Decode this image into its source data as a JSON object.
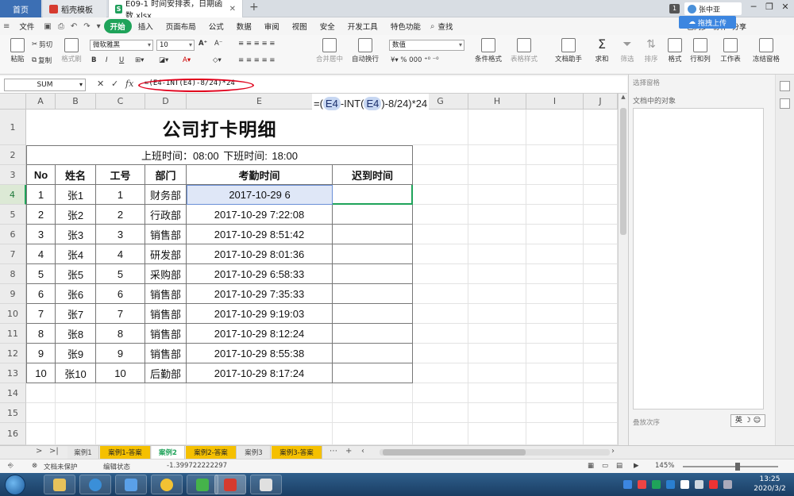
{
  "titlebar": {
    "home_tab": "首页",
    "wps_tab": "稻壳模板",
    "doc_tab": "E09-1 时间安排表，日期函数.xlsx",
    "new_tab": "+",
    "badge": "1",
    "user": "张中亚"
  },
  "menubar": {
    "file": "文件",
    "items": [
      "开始",
      "插入",
      "页面布局",
      "公式",
      "数据",
      "审阅",
      "视图",
      "安全",
      "开发工具",
      "特色功能"
    ],
    "search": "查找",
    "sync": "已同步",
    "collab": "协作",
    "share": "分享",
    "upload": "拖拽上传"
  },
  "ribbon": {
    "paste": "粘贴",
    "cut": "剪切",
    "copy": "复制",
    "format_painter": "格式刷",
    "font_name": "微软雅黑",
    "font_size": "10",
    "merge": "合并居中",
    "wrap": "自动换行",
    "number_format": "数值",
    "cond_format": "条件格式",
    "table_style": "表格样式",
    "doc_assistant": "文档助手",
    "sum": "求和",
    "filter": "筛选",
    "sort": "排序",
    "format": "格式",
    "rowcol": "行和列",
    "worksheet": "工作表",
    "freeze": "冻结窗格"
  },
  "formulabar": {
    "name_box": "SUM",
    "formula": "=(E4-INT(E4)-8/24)*24"
  },
  "columns": [
    "A",
    "B",
    "C",
    "D",
    "E",
    "F",
    "G",
    "H",
    "I",
    "J"
  ],
  "rows": [
    "1",
    "2",
    "3",
    "4",
    "5",
    "6",
    "7",
    "8",
    "9",
    "10",
    "11",
    "12",
    "13",
    "14",
    "15",
    "16"
  ],
  "sheet": {
    "title": "公司打卡明细",
    "time_line": "上班时间：08:00    下班时间: 18:00",
    "headers": [
      "No",
      "姓名",
      "工号",
      "部门",
      "考勤时间",
      "迟到时间"
    ],
    "records": [
      [
        "1",
        "张1",
        "1",
        "财务部",
        "2017-10-29 6"
      ],
      [
        "2",
        "张2",
        "2",
        "行政部",
        "2017-10-29 7:22:08"
      ],
      [
        "3",
        "张3",
        "3",
        "销售部",
        "2017-10-29 8:51:42"
      ],
      [
        "4",
        "张4",
        "4",
        "研发部",
        "2017-10-29 8:01:36"
      ],
      [
        "5",
        "张5",
        "5",
        "采购部",
        "2017-10-29 6:58:33"
      ],
      [
        "6",
        "张6",
        "6",
        "销售部",
        "2017-10-29 7:35:33"
      ],
      [
        "7",
        "张7",
        "7",
        "销售部",
        "2017-10-29 9:19:03"
      ],
      [
        "8",
        "张8",
        "8",
        "销售部",
        "2017-10-29 8:12:24"
      ],
      [
        "9",
        "张9",
        "9",
        "销售部",
        "2017-10-29 8:55:38"
      ],
      [
        "10",
        "张10",
        "10",
        "后勤部",
        "2017-10-29 8:17:24"
      ]
    ],
    "editing_formula": {
      "prefix": "=(",
      "ref1": "E4",
      "mid": "-INT(",
      "ref2": "E4",
      "suffix": ")-8/24)*24"
    }
  },
  "sidepane": {
    "title": "选择窗格",
    "label": "文档中的对象",
    "order": "叠放次序",
    "ime": "英 ☽ ☺"
  },
  "sheettabs": [
    "案例1",
    "案例1-答案",
    "案例2",
    "案例2-答案",
    "案例3",
    "案例3-答案"
  ],
  "statusbar": {
    "protect": "文档未保护",
    "edit_state": "编辑状态",
    "value": "-1.399722222297",
    "zoom": "145%"
  },
  "taskbar": {
    "time": "13:25",
    "date": "2020/3/2"
  },
  "colors": {
    "accent_green": "#1fa35a",
    "tab_yellow": "#f5c000",
    "oval_red": "#e0001b"
  }
}
